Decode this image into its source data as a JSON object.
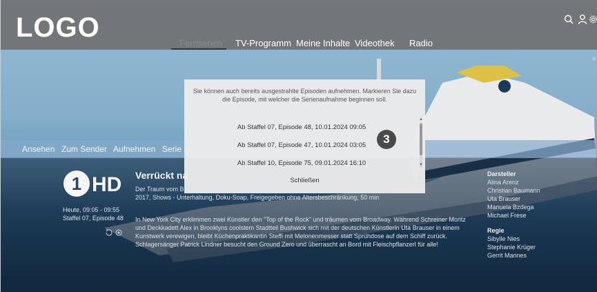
{
  "header": {
    "logo": "LOGO",
    "nav": [
      {
        "label": "Fernsehen",
        "active": true
      },
      {
        "label": "TV-Programm"
      },
      {
        "label": "Meine Inhalte"
      },
      {
        "label": "Videothek"
      },
      {
        "label": "Radio"
      }
    ],
    "icons": [
      "search-icon",
      "user-icon",
      "gear-icon"
    ]
  },
  "tabs": [
    "Ansehen",
    "Zum Sender",
    "Aufnehmen",
    "Serie a"
  ],
  "channel": {
    "logo_text": "HD",
    "logo_number": "1",
    "time": "Heute, 09:05 - 09:55",
    "episode": "Staffel 07, Episode 48"
  },
  "program": {
    "title": "Verrückt na",
    "line1": "Der Traum vom B",
    "line2": "2017, Shows - Unterhaltung, Doku-Soap, Freigegeben ohne Altersbeschränkung, 50 min",
    "description": "In New York City erklimmen zwei Künstler den \"Top of the Rock\" und träumen vom Broadway. Während Schreiner Moritz und Deckkadett Alex in Brooklyns coolstem Stadtteil Bushwick sich mit der deutschen Künstlerin Uta Brauser in einem Kunstwerk verewigen, bleibt Küchenpraktikantin Steffi mit Melonenmesser statt Sprühdose auf dem Schiff zurück. Schlagersänger Patrick Lindner besucht den Ground Zero und überrascht an Bord mit Fleischpflanzerl für alle!"
  },
  "credits": {
    "cast_heading": "Darsteller",
    "cast": [
      "Alina Arenz",
      "Christian Baumann",
      "Uta Brauser",
      "Manuela Bzdega",
      "Michael Frese"
    ],
    "director_heading": "Regie",
    "directors": [
      "Sibylle Nies",
      "Stephanie Krüger",
      "Gerrit Mannes"
    ]
  },
  "modal": {
    "message_line1": "Sie können auch bereits ausgestrahlte Episoden aufnehmen. Markieren Sie dazu",
    "message_line2": "die Episode, mit welcher die Serienaufnahme beginnen soll.",
    "options": [
      "Ab Staffel 07, Episode 48, 10.01.2024 09:05",
      "Ab Staffel 07, Episode 47, 10.01.2024 03:05",
      "Ab Staffel 10, Episode 75, 09.01.2024 16:10"
    ],
    "close_label": "Schließen",
    "badge": "3"
  },
  "close_x": "×"
}
